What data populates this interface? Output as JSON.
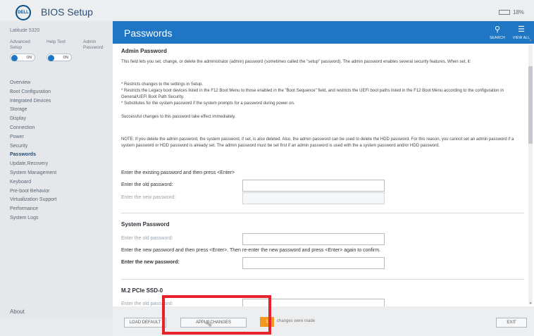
{
  "app": {
    "logo": "DELL",
    "title": "BIOS Setup",
    "battery": "18%"
  },
  "sidebar": {
    "model": "Latitude 5320",
    "toggles": [
      {
        "label": "Advanced Setup",
        "state": "ON"
      },
      {
        "label": "Help Text",
        "state": "ON"
      },
      {
        "label": "Admin Password",
        "state": ""
      }
    ],
    "items": [
      {
        "label": "Overview"
      },
      {
        "label": "Boot Configuration"
      },
      {
        "label": "Integrated Devices"
      },
      {
        "label": "Storage"
      },
      {
        "label": "Display"
      },
      {
        "label": "Connection"
      },
      {
        "label": "Power"
      },
      {
        "label": "Security"
      },
      {
        "label": "Passwords"
      },
      {
        "label": "Update,Recovery"
      },
      {
        "label": "System Management"
      },
      {
        "label": "Keyboard"
      },
      {
        "label": "Pre-boot Behavior"
      },
      {
        "label": "Virtualization Support"
      },
      {
        "label": "Performance"
      },
      {
        "label": "System Logs"
      }
    ],
    "about": "About"
  },
  "header": {
    "title": "Passwords",
    "search_label": "SEARCH",
    "search_icon": "search-icon",
    "viewall_label": "VIEW ALL",
    "viewall_icon": "view-all-icon",
    "color": "#1f76c5"
  },
  "admin": {
    "title": "Admin Password",
    "description": "This field lets you set, change, or delete the administrator (admin) password (sometimes called the \"setup\" password). The admin password enables several security features. When set, it:",
    "bullets": [
      "* Restricts changes to the settings in Setup.",
      "* Restricts the Legacy boot devices listed in the F12 Boot Menu to those enabled in the \"Boot Sequence\" field, and restricts the UEFI boot paths listed in the F12 Boot Menu according to the configuration in General/UEFI Boot Path Security.",
      "* Substitutes for the system password if the system prompts for a password during power on."
    ],
    "success": "Successful changes to this password take effect immediately.",
    "note": "NOTE: If you delete the admin password, the system password, if set, is also deleted. Also, the admin password can be used to delete the HDD password. For this reason, you cannot set an admin password if a system password or HDD password is already set. The admin password must be set first if an admin password is used with the a system password and/or HDD password.",
    "instruction": "Enter the existing password and then press <Enter>",
    "old_label": "Enter the old password:",
    "new_label": "Enter the new password:"
  },
  "system": {
    "title": "System Password",
    "old_label": "Enter the old password:",
    "instruction": "Enter the new password and then press <Enter>. Then re-enter the new password and press <Enter> again to confirm.",
    "new_label": "Enter the new password:"
  },
  "ssd": {
    "title": "M.2 PCIe SSD-0",
    "old_label": "Enter the old password:"
  },
  "bottom": {
    "load_default": "LOAD DEFAULT",
    "apply_changes": "APPLY CHANGES",
    "changes_count": "1",
    "changes_text": "changes were made",
    "exit": "EXIT",
    "chip_color": "#f29a1e"
  },
  "annotation": {
    "color": "#e8222b"
  }
}
